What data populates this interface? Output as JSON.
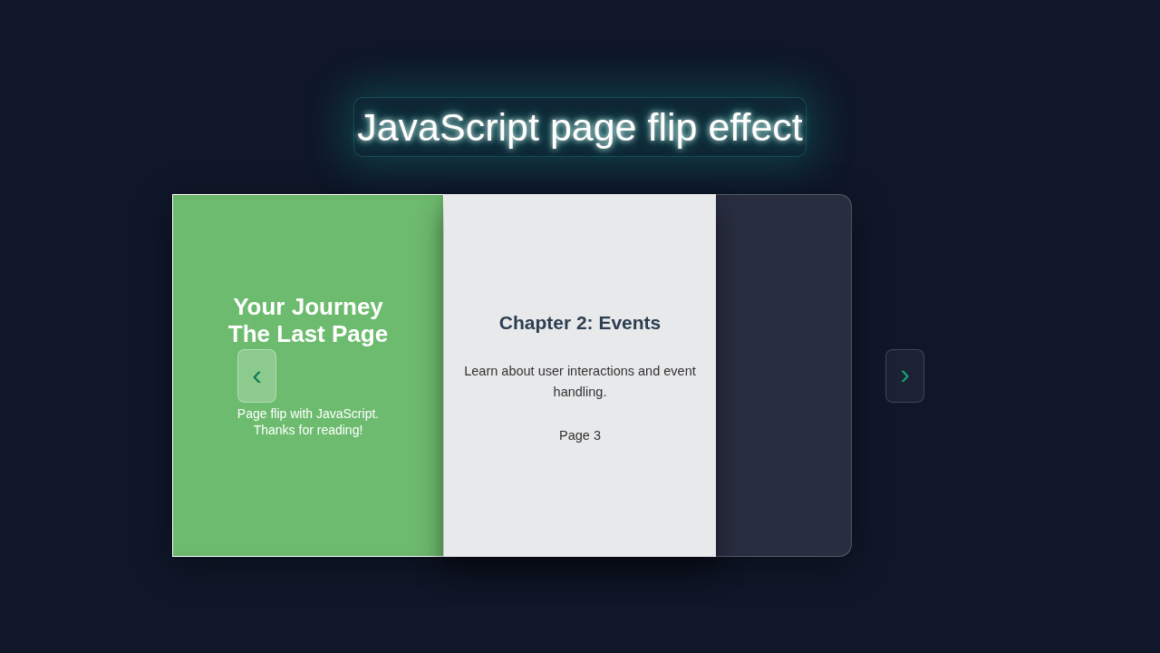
{
  "title": "JavaScript page flip effect",
  "book": {
    "flipped_pages": [
      {
        "title": "Your Journey",
        "text": "Page flip with JavaScript."
      },
      {
        "title": "The Last Page",
        "text": "Thanks for reading!"
      }
    ],
    "current_page": {
      "title": "Chapter 2: Events",
      "text": "Learn about user interactions and event handling.",
      "page_label": "Page 3"
    }
  },
  "nav": {
    "prev": "‹",
    "next": "›"
  }
}
